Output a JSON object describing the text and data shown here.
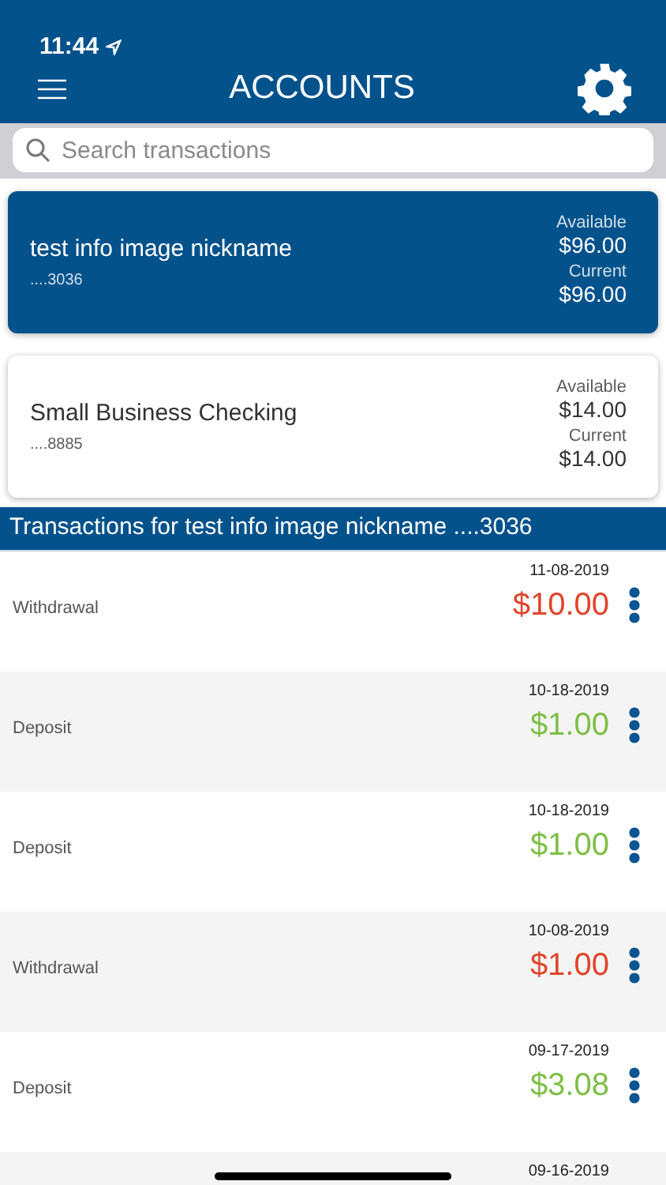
{
  "status_bar": {
    "time": "11:44"
  },
  "header": {
    "title": "ACCOUNTS"
  },
  "search": {
    "placeholder": "Search transactions"
  },
  "accounts": [
    {
      "name": "test info image nickname",
      "number": "....3036",
      "available_label": "Available",
      "available": "$96.00",
      "current_label": "Current",
      "current": "$96.00",
      "selected": true
    },
    {
      "name": "Small Business Checking",
      "number": "....8885",
      "available_label": "Available",
      "available": "$14.00",
      "current_label": "Current",
      "current": "$14.00",
      "selected": false
    }
  ],
  "transactions_title": "Transactions for test info image nickname ....3036",
  "transactions": [
    {
      "kind": "withdrawal",
      "description": "Withdrawal",
      "date": "11-08-2019",
      "amount": "$10.00"
    },
    {
      "kind": "deposit",
      "description": "Deposit",
      "date": "10-18-2019",
      "amount": "$1.00"
    },
    {
      "kind": "deposit",
      "description": "Deposit",
      "date": "10-18-2019",
      "amount": "$1.00"
    },
    {
      "kind": "withdrawal",
      "description": "Withdrawal",
      "date": "10-08-2019",
      "amount": "$1.00"
    },
    {
      "kind": "deposit",
      "description": "Deposit",
      "date": "09-17-2019",
      "amount": "$3.08"
    },
    {
      "kind": "partial",
      "date": "09-16-2019"
    }
  ]
}
